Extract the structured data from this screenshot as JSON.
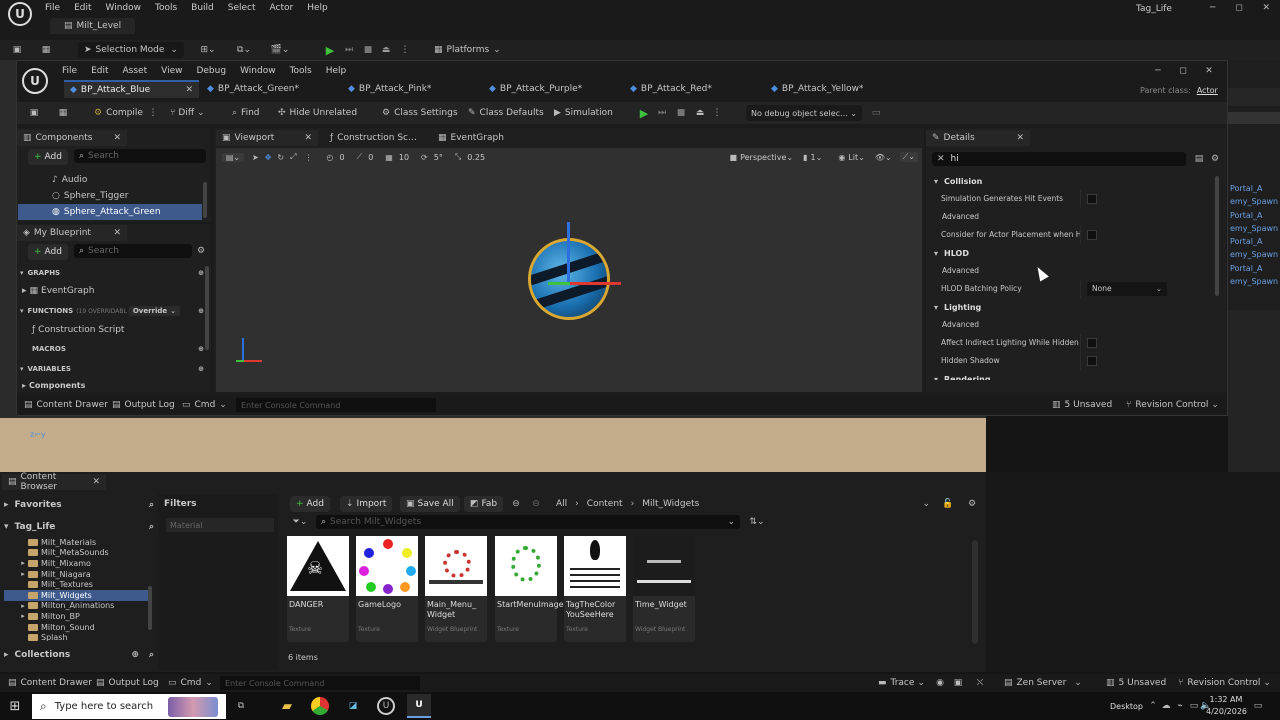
{
  "main_window": {
    "menu": [
      "File",
      "Edit",
      "Window",
      "Tools",
      "Build",
      "Select",
      "Actor",
      "Help"
    ],
    "project": "Tag_Life",
    "level_tab": "Milt_Level",
    "selection_mode": "Selection Mode",
    "platforms": "Platforms"
  },
  "bp_editor": {
    "menu": [
      "File",
      "Edit",
      "Asset",
      "View",
      "Debug",
      "Window",
      "Tools",
      "Help"
    ],
    "tabs": [
      {
        "label": "BP_Attack_Blue",
        "active": true
      },
      {
        "label": "BP_Attack_Green*",
        "active": false
      },
      {
        "label": "BP_Attack_Pink*",
        "active": false
      },
      {
        "label": "BP_Attack_Purple*",
        "active": false
      },
      {
        "label": "BP_Attack_Red*",
        "active": false
      },
      {
        "label": "BP_Attack_Yellow*",
        "active": false
      }
    ],
    "parent_class_label": "Parent class:",
    "parent_class_value": "Actor",
    "toolbar": {
      "compile": "Compile",
      "diff": "Diff",
      "find": "Find",
      "hide_unrelated": "Hide Unrelated",
      "class_settings": "Class Settings",
      "class_defaults": "Class Defaults",
      "simulation": "Simulation",
      "debug_object": "No debug object selected"
    },
    "components": {
      "title": "Components",
      "add": "Add",
      "search_placeholder": "Search",
      "items": [
        "Audio",
        "Sphere_Tigger",
        "Sphere_Attack_Green"
      ]
    },
    "my_blueprint": {
      "title": "My Blueprint",
      "add": "Add",
      "search_placeholder": "Search",
      "graphs": "GRAPHS",
      "event_graph": "EventGraph",
      "functions": "FUNCTIONS",
      "functions_count": "(19 OVERRIDABL",
      "override": "Override",
      "construction_script": "Construction Script",
      "macros": "MACROS",
      "variables": "VARIABLES",
      "components": "Components"
    },
    "viewport_tabs": [
      "Viewport",
      "Construction Scr...",
      "EventGraph"
    ],
    "viewport_toolbar": {
      "angle": "0",
      "grid": "10",
      "rot": "5°",
      "scale": "0.25",
      "perspective": "Perspective",
      "cam_speed": "1",
      "lit": "Lit"
    },
    "details": {
      "title": "Details",
      "search_value": "hi",
      "sections": [
        {
          "name": "Collision",
          "rows": [
            {
              "label": "Simulation Generates Hit Events",
              "kind": "check"
            },
            {
              "label": "Advanced",
              "kind": "adv"
            },
            {
              "label": "Consider for Actor Placement when Hi...",
              "kind": "check"
            }
          ]
        },
        {
          "name": "HLOD",
          "rows": [
            {
              "label": "Advanced",
              "kind": "adv"
            },
            {
              "label": "HLOD Batching Policy",
              "kind": "select",
              "value": "None"
            }
          ]
        },
        {
          "name": "Lighting",
          "rows": [
            {
              "label": "Advanced",
              "kind": "adv"
            },
            {
              "label": "Affect Indirect Lighting While Hidden",
              "kind": "check"
            },
            {
              "label": "Hidden Shadow",
              "kind": "check"
            }
          ]
        },
        {
          "name": "Rendering",
          "rows": []
        }
      ]
    },
    "bottom": {
      "content_drawer": "Content Drawer",
      "output_log": "Output Log",
      "cmd": "Cmd",
      "console_placeholder": "Enter Console Command",
      "unsaved": "5 Unsaved",
      "revision": "Revision Control"
    }
  },
  "outliner_items": [
    "Portal_A",
    "emy_Spawn",
    "Portal_A",
    "emy_Spawn",
    "Portal_A",
    "emy_Spawn",
    "Portal_A",
    "emy_Spawn"
  ],
  "content_browser": {
    "tab": "Content Browser",
    "favorites": "Favorites",
    "project": "Tag_Life",
    "folders": [
      "Milt_Materials",
      "Milt_MetaSounds",
      "Milt_Mixamo",
      "Milt_Niagara",
      "Milt_Textures",
      "Milt_Widgets",
      "Milton_Animations",
      "Milton_BP",
      "Milton_Sound",
      "Splash"
    ],
    "selected_folder": "Milt_Widgets",
    "collections": "Collections",
    "filters": "Filters",
    "filter_chip": "Material",
    "add": "Add",
    "import": "Import",
    "save_all": "Save All",
    "fab": "Fab",
    "path": [
      "All",
      "Content",
      "Milt_Widgets"
    ],
    "search_placeholder": "Search Milt_Widgets",
    "assets": [
      {
        "name": "DANGER",
        "type": "Texture"
      },
      {
        "name": "GameLogo",
        "type": "Texture"
      },
      {
        "name": "Main_Menu_\nWidget",
        "type": "Widget Blueprint"
      },
      {
        "name": "StartMenuImage",
        "type": "Texture"
      },
      {
        "name": "TagTheColor\nYouSeeHere",
        "type": "Texture"
      },
      {
        "name": "Time_Widget",
        "type": "Widget Blueprint"
      }
    ],
    "count": "6 items"
  },
  "status_bar": {
    "content_drawer": "Content Drawer",
    "output_log": "Output Log",
    "cmd": "Cmd",
    "console_placeholder": "Enter Console Command",
    "trace": "Trace",
    "zen": "Zen Server",
    "unsaved": "5 Unsaved",
    "revision": "Revision Control"
  },
  "taskbar": {
    "search_placeholder": "Type here to search",
    "desktop": "Desktop",
    "time": "1:32 AM",
    "date": "4/20/2026"
  },
  "colors": {
    "accent": "#2e5fa8",
    "selected_row": "#3e5a8c",
    "play_green": "#3ec23e"
  }
}
